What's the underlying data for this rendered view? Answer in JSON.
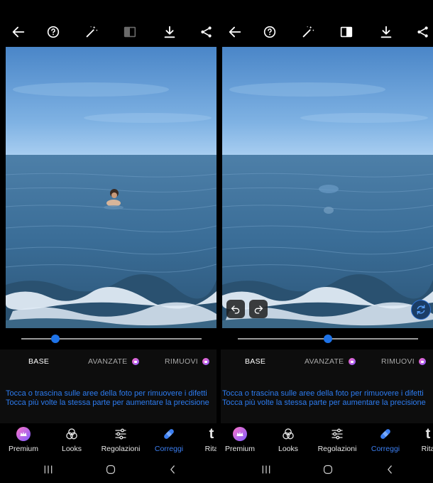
{
  "tabs": {
    "base": "BASE",
    "avanzate": "AVANZATE",
    "rimuovi": "RIMUOVI"
  },
  "hints": {
    "line1": "Tocca o trascina sulle aree della foto per rimuovere i difetti",
    "line2": "Tocca più volte la stessa parte per aumentare la precisione"
  },
  "tools": {
    "premium": "Premium",
    "looks": "Looks",
    "regolazioni": "Regolazioni",
    "correggi": "Correggi",
    "ritaglia": "Rita"
  },
  "slider": {
    "left_value_fraction": 0.19,
    "right_value_fraction": 0.5
  },
  "icons": {
    "back": "arrow-left-icon",
    "help": "help-circle-icon",
    "auto_fix": "magic-wand-icon",
    "compare": "split-compare-icon",
    "download": "download-icon",
    "share": "share-icon",
    "undo": "undo-icon",
    "redo": "redo-icon",
    "reset": "refresh-icon"
  },
  "colors": {
    "accent": "#2d7cf0",
    "active_tool": "#3c7ff2",
    "hint_text": "#2d7cf0",
    "panel_bg": "#0d0d0d"
  }
}
